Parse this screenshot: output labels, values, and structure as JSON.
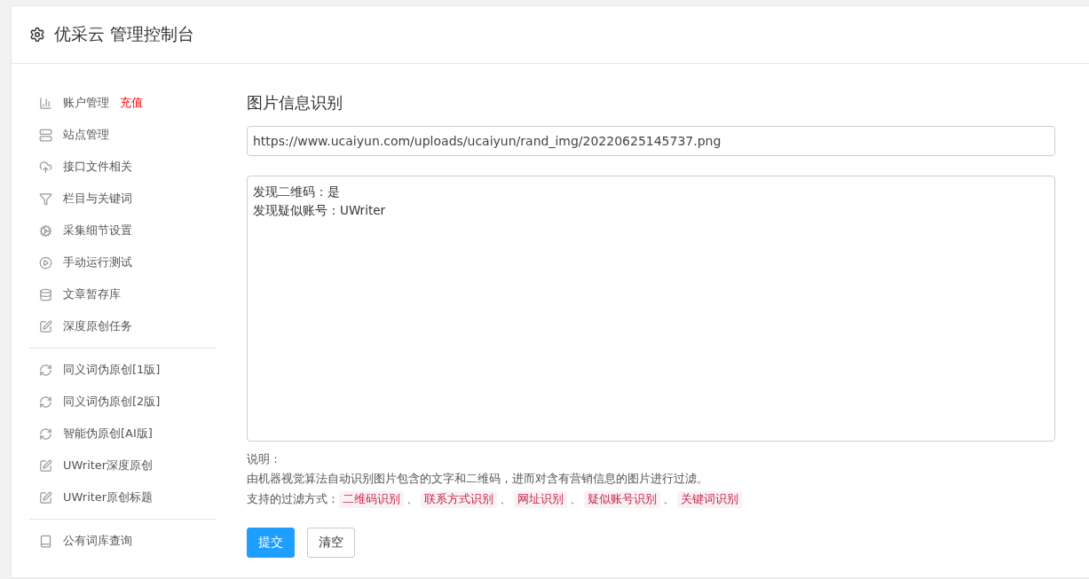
{
  "header": {
    "title": "优采云 管理控制台"
  },
  "sidebar": {
    "groups": [
      {
        "items": [
          {
            "label": "账户管理",
            "badge": "充值"
          },
          {
            "label": "站点管理"
          },
          {
            "label": "接口文件相关"
          },
          {
            "label": "栏目与关键词"
          },
          {
            "label": "采集细节设置"
          },
          {
            "label": "手动运行测试"
          },
          {
            "label": "文章暂存库"
          },
          {
            "label": "深度原创任务"
          }
        ]
      },
      {
        "items": [
          {
            "label": "同义词伪原创[1版]"
          },
          {
            "label": "同义词伪原创[2版]"
          },
          {
            "label": "智能伪原创[AI版]"
          },
          {
            "label": "UWriter深度原创"
          },
          {
            "label": "UWriter原创标题"
          }
        ]
      },
      {
        "items": [
          {
            "label": "公有词库查询"
          }
        ]
      }
    ]
  },
  "main": {
    "title": "图片信息识别",
    "url_field": {
      "value": "https://www.ucaiyun.com/uploads/ucaiyun/rand_img/20220625145737.png"
    },
    "result": {
      "lines": [
        "发现二维码：是",
        "发现疑似账号：UWriter"
      ]
    },
    "notes": {
      "heading": "说明：",
      "description": "由机器视觉算法自动识别图片包含的文字和二维码，进而对含有营销信息的图片进行过滤。",
      "filters_label": "支持的过滤方式：",
      "separator": "、",
      "filters": [
        "二维码识别",
        "联系方式识别",
        "网址识别",
        "疑似账号识别",
        "关键词识别"
      ]
    },
    "buttons": [
      {
        "label": "提交",
        "kind": "primary"
      },
      {
        "label": "清空",
        "kind": "default"
      }
    ]
  }
}
